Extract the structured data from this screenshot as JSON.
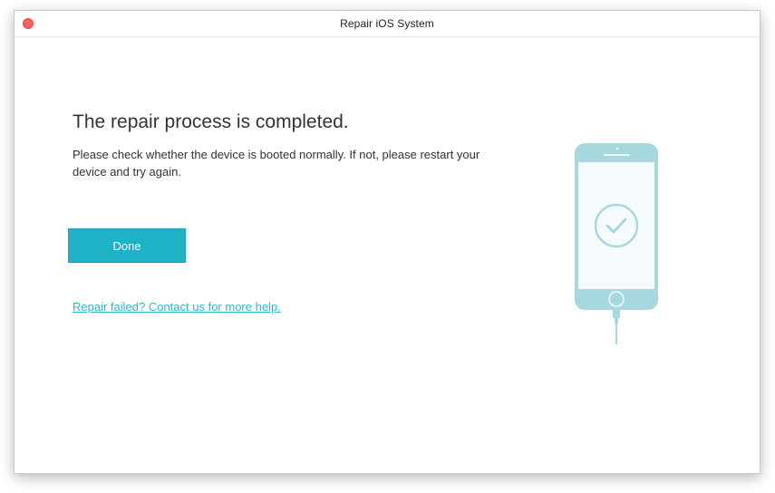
{
  "window": {
    "title": "Repair iOS System"
  },
  "main": {
    "heading": "The repair process is completed.",
    "message": "Please check whether the device is booted normally. If not, please restart your device and try again.",
    "done_label": "Done",
    "help_link_label": "Repair failed? Contact us for more help."
  },
  "illustration": {
    "icon": "phone-check-icon",
    "accent_color": "#a6d8dd",
    "screen_color": "#f5fbfd"
  },
  "colors": {
    "primary_button": "#1fb2c6",
    "link": "#2db8ca",
    "close_button": "#fc605c"
  }
}
